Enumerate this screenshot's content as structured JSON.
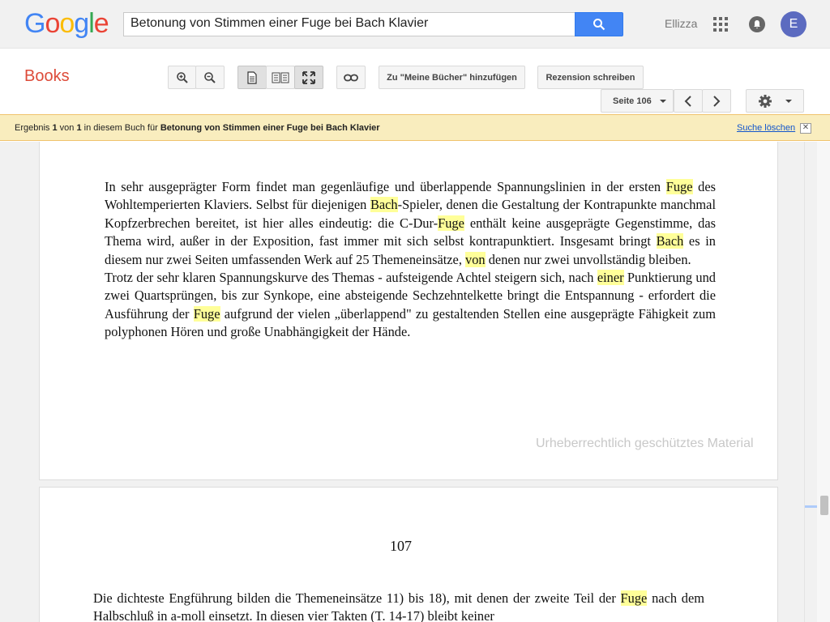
{
  "header": {
    "logo_letters": [
      {
        "ch": "G",
        "color": "#4285f4"
      },
      {
        "ch": "o",
        "color": "#ea4335"
      },
      {
        "ch": "o",
        "color": "#fbbc05"
      },
      {
        "ch": "g",
        "color": "#4285f4"
      },
      {
        "ch": "l",
        "color": "#34a853"
      },
      {
        "ch": "e",
        "color": "#ea4335"
      }
    ],
    "search_value": "Betonung von Stimmen einer Fuge bei Bach Klavier",
    "user_name": "Ellizza",
    "avatar_letter": "E",
    "search_icon": "search-icon",
    "apps_icon": "apps-grid-icon",
    "notifications_icon": "bell-icon"
  },
  "toolbar": {
    "books_label": "Books",
    "add_to_library": "Zu \"Meine Bücher\" hinzufügen",
    "write_review": "Rezension schreiben",
    "page_select": "Seite 106",
    "icons": [
      "zoom-in-icon",
      "zoom-out-icon",
      "single-page-icon",
      "two-page-icon",
      "fullscreen-icon",
      "link-icon",
      "prev-page-icon",
      "next-page-icon",
      "settings-gear-icon"
    ]
  },
  "banner": {
    "prefix": "Ergebnis ",
    "result_num": "1",
    "of": " von ",
    "total": "1",
    "middle": " in diesem Buch für ",
    "query": "Betonung von Stimmen einer Fuge bei Bach Klavier",
    "clear_label": "Suche löschen",
    "close_symbol": "✕"
  },
  "page1": {
    "copyright": "Urheberrechtlich geschütztes Material"
  },
  "page2": {
    "page_number": "107"
  },
  "colors": {
    "highlight": "#ffff99",
    "banner_bg": "#f9edbe",
    "books_red": "#dd4b39",
    "search_blue": "#4285f4"
  }
}
